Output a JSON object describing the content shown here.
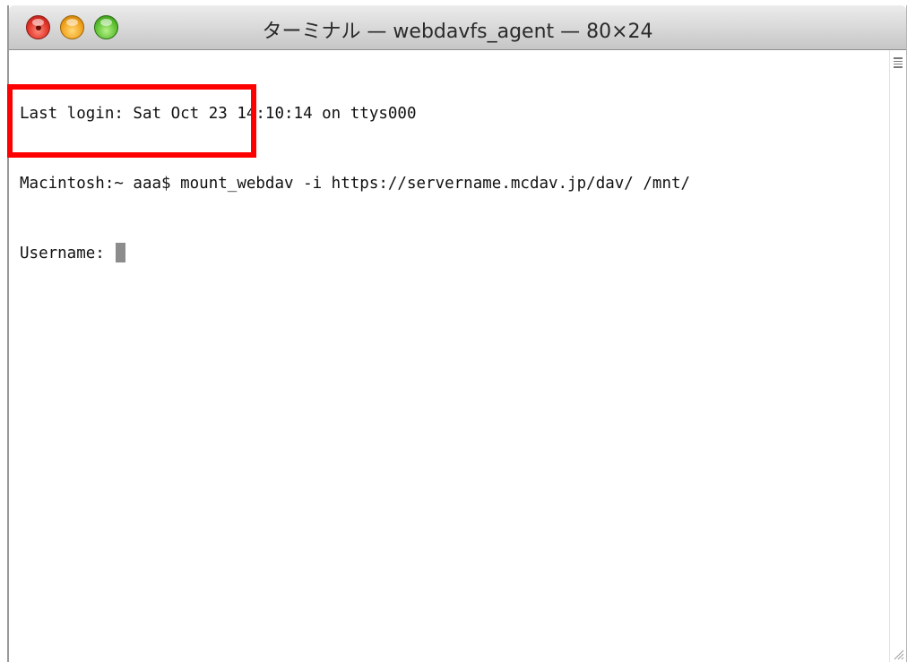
{
  "window": {
    "title": "ターミナル — webdavfs_agent — 80×24"
  },
  "terminal": {
    "lines": [
      "Last login: Sat Oct 23 14:10:14 on ttys000",
      "Macintosh:~ aaa$ mount_webdav -i https://servername.mcdav.jp/dav/ /mnt/",
      "Username: "
    ]
  },
  "icons": {
    "close": "close-button-icon",
    "minimize": "minimize-button-icon",
    "zoom": "zoom-button-icon",
    "split": "split-view-icon",
    "resize": "resize-grip-icon"
  },
  "colors": {
    "highlight": "#ff0000",
    "cursor": "#8c8c8c",
    "close": "#e2362a",
    "minimize": "#f2a31d",
    "zoom": "#5fc233"
  }
}
